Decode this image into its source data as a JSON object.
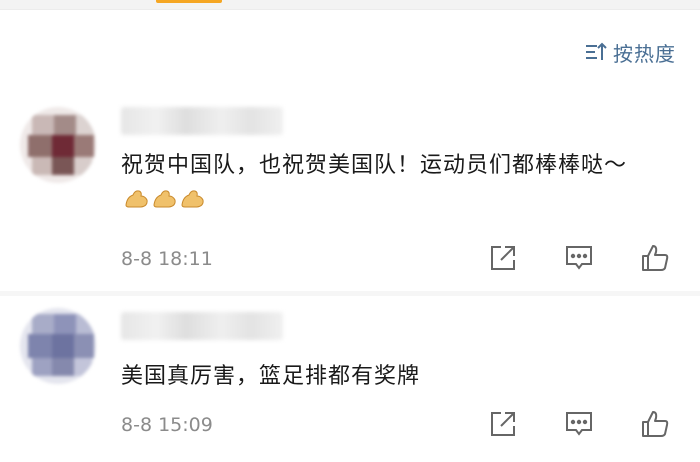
{
  "sort": {
    "label": "按热度"
  },
  "comments": [
    {
      "text": "祝贺中国队，也祝贺美国队！运动员们都棒棒哒～",
      "time": "8-8 18:11"
    },
    {
      "text": "美国真厉害，篮足排都有奖牌",
      "time": "8-8 15:09"
    }
  ],
  "colors": {
    "sort_accent": "#4a6f94",
    "tab_accent": "#f5a623",
    "time_text": "#8b8b8b"
  },
  "icons": [
    "sort-icon",
    "share-icon",
    "reply-icon",
    "like-icon",
    "muscle-emoji"
  ]
}
